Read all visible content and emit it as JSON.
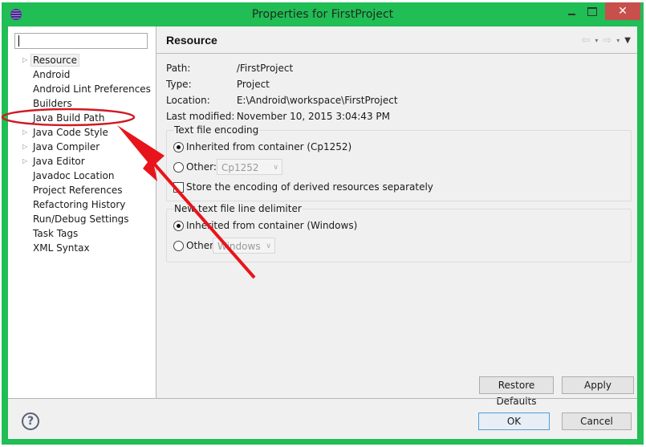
{
  "window": {
    "title": "Properties for FirstProject",
    "controls": {
      "minimize": "–",
      "maximize": "□",
      "close": "✕"
    }
  },
  "sidebar": {
    "filter_value": "",
    "items": [
      {
        "label": "Resource",
        "expandable": true,
        "selected": true
      },
      {
        "label": "Android",
        "expandable": false
      },
      {
        "label": "Android Lint Preferences",
        "expandable": false
      },
      {
        "label": "Builders",
        "expandable": false
      },
      {
        "label": "Java Build Path",
        "expandable": false,
        "highlighted": true
      },
      {
        "label": "Java Code Style",
        "expandable": true
      },
      {
        "label": "Java Compiler",
        "expandable": true
      },
      {
        "label": "Java Editor",
        "expandable": true
      },
      {
        "label": "Javadoc Location",
        "expandable": false
      },
      {
        "label": "Project References",
        "expandable": false
      },
      {
        "label": "Refactoring History",
        "expandable": false
      },
      {
        "label": "Run/Debug Settings",
        "expandable": false
      },
      {
        "label": "Task Tags",
        "expandable": false
      },
      {
        "label": "XML Syntax",
        "expandable": false
      }
    ]
  },
  "page": {
    "title": "Resource",
    "nav": {
      "back": "⇦",
      "forward": "⇨",
      "dropdown": "▾",
      "menu": "▼"
    },
    "properties": [
      {
        "label": "Path:",
        "value": "/FirstProject"
      },
      {
        "label": "Type:",
        "value": "Project"
      },
      {
        "label": "Location:",
        "value": "E:\\Android\\workspace\\FirstProject"
      },
      {
        "label": "Last modified:",
        "value": "November 10, 2015 3:04:43 PM"
      }
    ],
    "encoding_group": {
      "title": "Text file encoding",
      "inherited_label": "Inherited from container (Cp1252)",
      "inherited_selected": true,
      "other_label": "Other:",
      "other_value": "Cp1252",
      "store_label": "Store the encoding of derived resources separately",
      "store_checked": false
    },
    "delimiter_group": {
      "title": "New text file line delimiter",
      "inherited_label": "Inherited from container (Windows)",
      "inherited_selected": true,
      "other_label": "Other:",
      "other_value": "Windows"
    },
    "restore_defaults_label": "Restore Defaults",
    "apply_label": "Apply"
  },
  "footer": {
    "help": "?",
    "ok_label": "OK",
    "cancel_label": "Cancel"
  },
  "annotation": {
    "color": "#e8141b",
    "target": "Java Build Path"
  }
}
